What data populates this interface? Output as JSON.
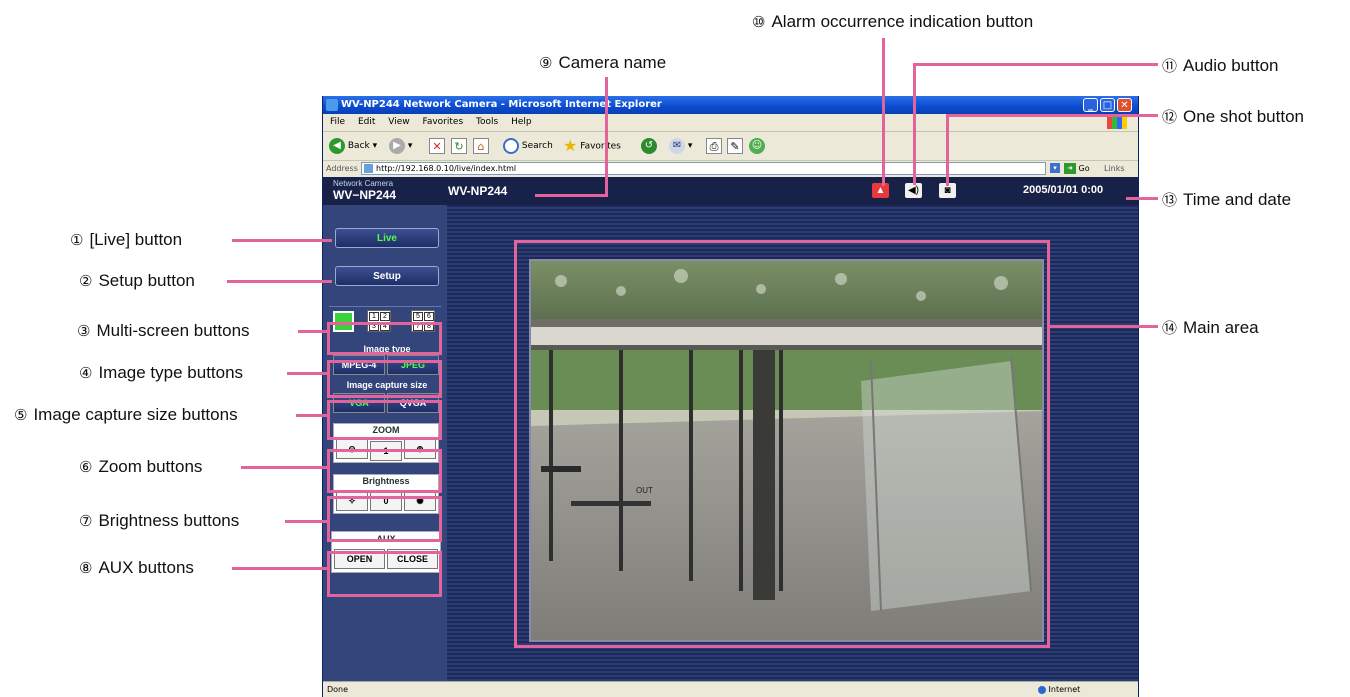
{
  "callouts": {
    "live": {
      "num": "①",
      "text": "[Live] button"
    },
    "setup": {
      "num": "②",
      "text": "Setup button"
    },
    "multiscreen": {
      "num": "③",
      "text": "Multi-screen buttons"
    },
    "imagetype": {
      "num": "④",
      "text": "Image type buttons"
    },
    "capturesize": {
      "num": "⑤",
      "text": "Image capture size buttons"
    },
    "zoom": {
      "num": "⑥",
      "text": "Zoom buttons"
    },
    "brightness": {
      "num": "⑦",
      "text": "Brightness buttons"
    },
    "aux": {
      "num": "⑧",
      "text": "AUX buttons"
    },
    "camname": {
      "num": "⑨",
      "text": "Camera name"
    },
    "alarm": {
      "num": "⑩",
      "text": "Alarm occurrence indication button"
    },
    "audio": {
      "num": "⑪",
      "text": "Audio button"
    },
    "oneshot": {
      "num": "⑫",
      "text": "One shot button"
    },
    "timedate": {
      "num": "⑬",
      "text": "Time and date"
    },
    "mainarea": {
      "num": "⑭",
      "text": "Main area"
    }
  },
  "browser": {
    "title": "WV-NP244 Network Camera - Microsoft Internet Explorer",
    "menu": [
      "File",
      "Edit",
      "View",
      "Favorites",
      "Tools",
      "Help"
    ],
    "toolbar": {
      "back": "Back",
      "search": "Search",
      "favorites": "Favorites"
    },
    "address_label": "Address",
    "address": "http://192.168.0.10/live/index.html",
    "go": "Go",
    "links": "Links",
    "status_left": "Done",
    "status_right": "Internet"
  },
  "camera": {
    "network_camera_label": "Network Camera",
    "model": "WV−NP244",
    "camera_name": "WV-NP244",
    "datetime": "2005/01/01  0:00",
    "live_label": "Live",
    "setup_label": "Setup",
    "multiscreen_4": [
      "1",
      "2",
      "3",
      "4"
    ],
    "multiscreen_8": [
      "5",
      "6",
      "7",
      "8"
    ],
    "image_type_label": "Image type",
    "image_type_options": [
      "MPEG-4",
      "JPEG"
    ],
    "capture_size_label": "Image capture size",
    "capture_size_options": [
      "VGA",
      "QVGA"
    ],
    "zoom_label": "ZOOM",
    "zoom_value": "1",
    "brightness_label": "Brightness",
    "brightness_value": "0",
    "aux_label": "AUX",
    "aux_open": "OPEN",
    "aux_close": "CLOSE",
    "scene_sign": "OUT"
  },
  "colors": {
    "callout_line": "#e3649a",
    "active_button_text": "#4dff4d"
  }
}
